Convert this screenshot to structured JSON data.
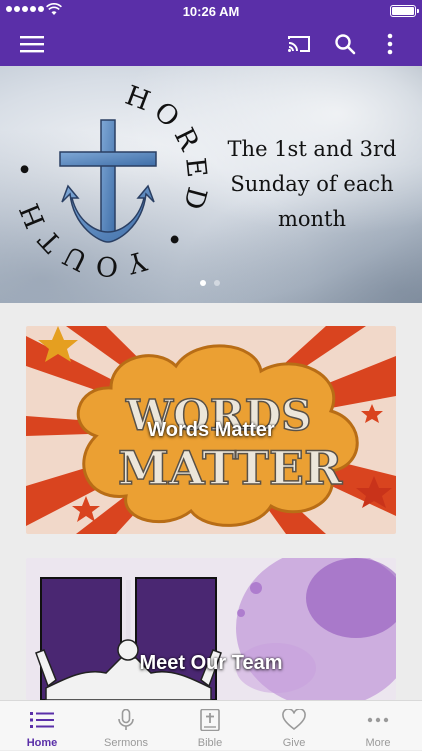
{
  "status_bar": {
    "time": "10:26 AM"
  },
  "colors": {
    "brand": "#5a2fa8",
    "tab_inactive": "#9a9a9a"
  },
  "app_bar": {
    "icons": [
      "menu-icon",
      "cast-icon",
      "search-icon",
      "more-vertical-icon"
    ]
  },
  "hero": {
    "logo_ring_text": "ANCHORED YOUTH",
    "tagline_lines": [
      "The 1st and 3rd",
      "Sunday of each",
      "month"
    ],
    "page_index": 1,
    "page_count": 2
  },
  "cards": [
    {
      "title": "Words Matter",
      "art_text": [
        "WORDS",
        "MATTER"
      ]
    },
    {
      "title": "Meet Our Team"
    }
  ],
  "tabs": [
    {
      "label": "Home",
      "icon": "list-icon",
      "active": true
    },
    {
      "label": "Sermons",
      "icon": "microphone-icon",
      "active": false
    },
    {
      "label": "Bible",
      "icon": "bible-icon",
      "active": false
    },
    {
      "label": "Give",
      "icon": "heart-icon",
      "active": false
    },
    {
      "label": "More",
      "icon": "more-horizontal-icon",
      "active": false
    }
  ]
}
